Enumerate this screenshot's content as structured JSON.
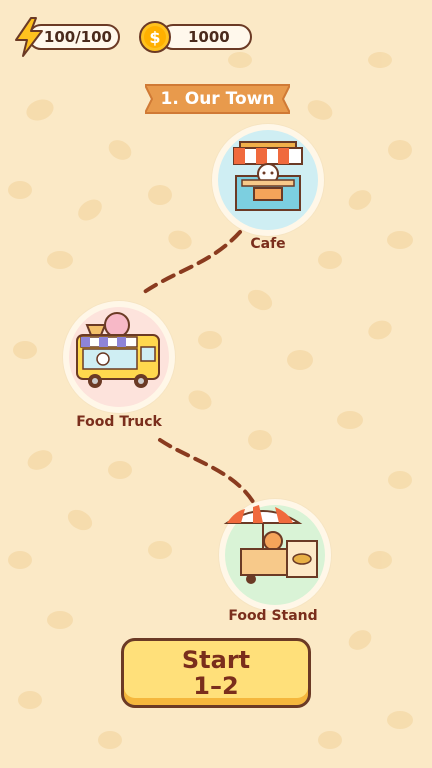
{
  "hud": {
    "energy": "100/100",
    "coins": "1000"
  },
  "level": {
    "title": "1. Our Town"
  },
  "stations": [
    {
      "label": "Cafe"
    },
    {
      "label": "Food Truck"
    },
    {
      "label": "Food Stand"
    }
  ],
  "start_button": {
    "line1": "Start",
    "line2": "1–2"
  },
  "colors": {
    "background": "#fbe9c6",
    "banner": "#e89a4c",
    "button": "#ffe07a",
    "path": "#8a3b1f"
  }
}
